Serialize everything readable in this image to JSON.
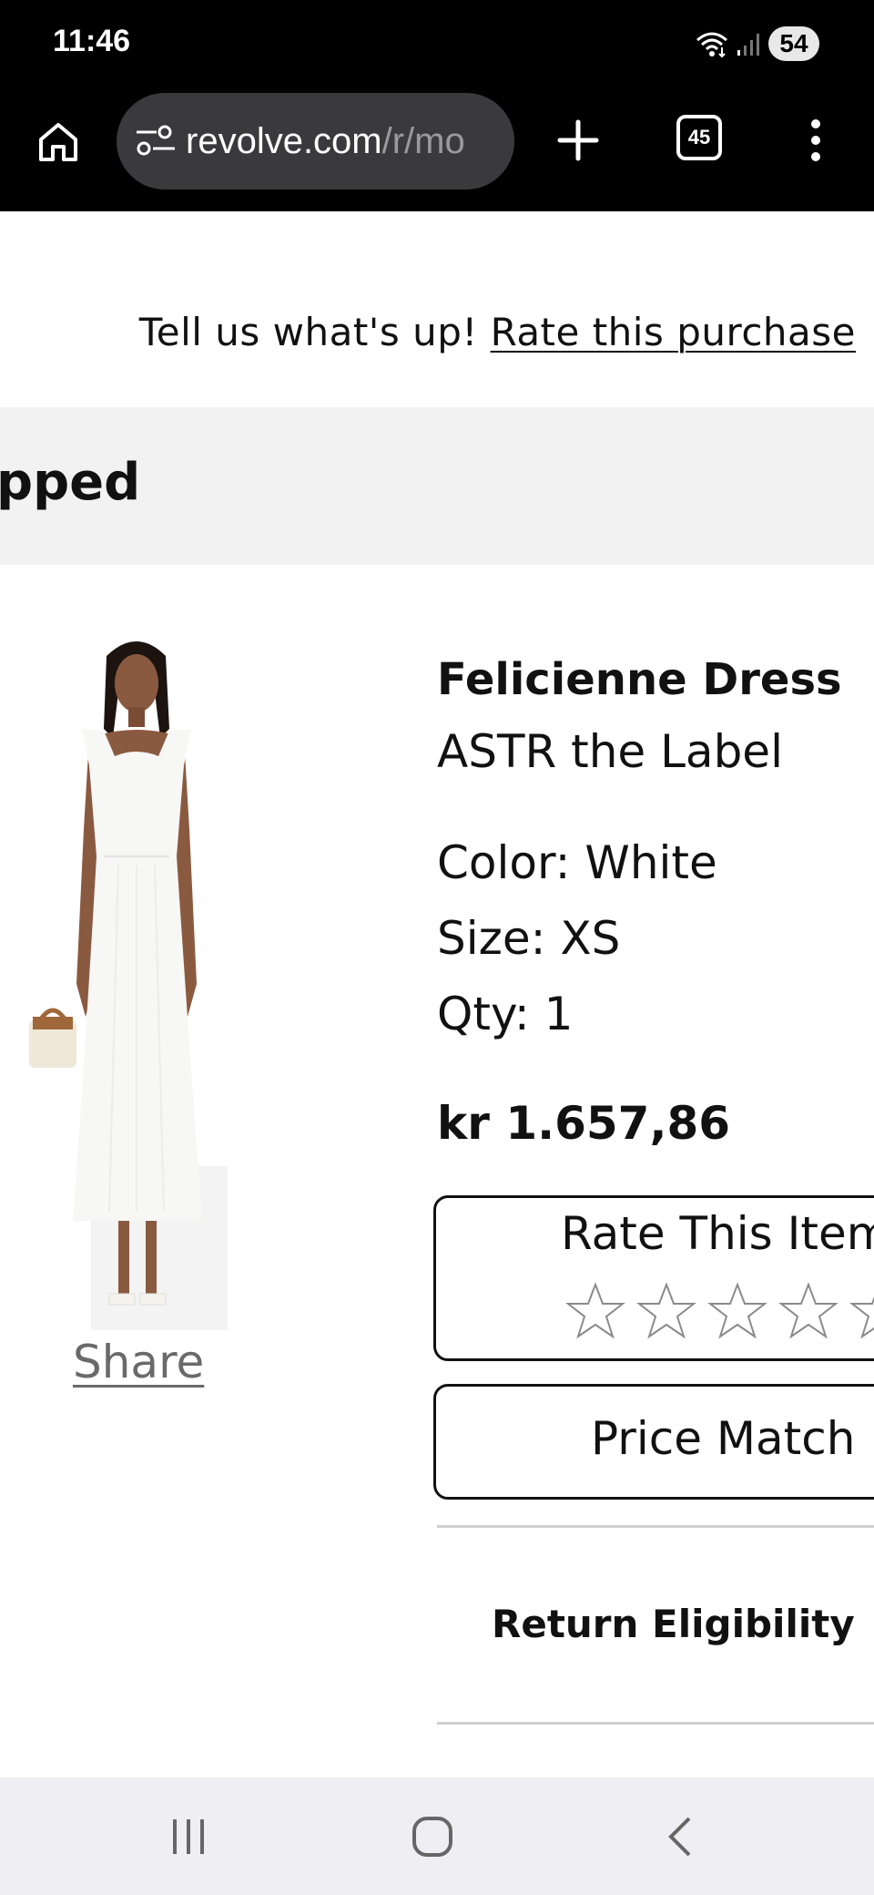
{
  "status_bar": {
    "time": "11:46",
    "battery": "54",
    "icons": [
      "wifi-icon",
      "signal-icon",
      "battery-icon"
    ]
  },
  "browser": {
    "url_host": "revolve.com",
    "url_path": "/r/mo",
    "tab_count": "45",
    "icons": [
      "home-icon",
      "site-settings-icon",
      "plus-icon",
      "more-vert-icon"
    ]
  },
  "banner": {
    "prompt": "Tell us what's up! ",
    "link": "Rate this purchase"
  },
  "order_status": {
    "heading": "pped"
  },
  "product": {
    "share": "Share",
    "name": "Felicienne Dress",
    "brand": "ASTR the Label",
    "color": "Color: White",
    "size": "Size: XS",
    "qty": "Qty: 1",
    "price": "kr 1.657,86",
    "rate_item_label": "Rate This Item",
    "rating": 0,
    "price_match_label": "Price Match",
    "return_eligibility": "Return Eligibility"
  },
  "colors": {
    "status_bar_bg": "#000000",
    "url_pill_bg": "#3a3a3c",
    "status_section_bg": "#f2f2f2",
    "nav_bar_bg": "#eeeef3",
    "share_link": "#6a6a6a"
  }
}
